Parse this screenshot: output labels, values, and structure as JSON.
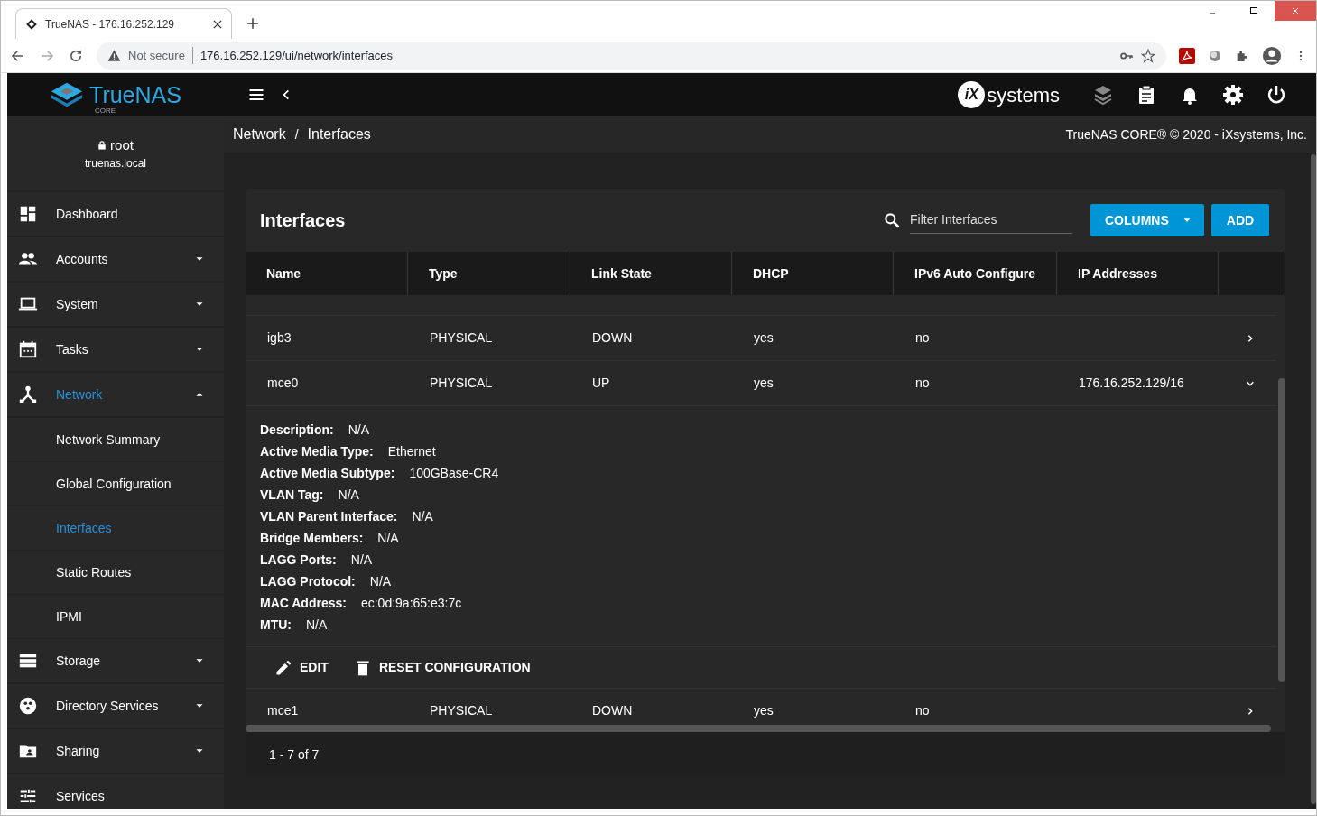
{
  "browser": {
    "tab_title": "TrueNAS - 176.16.252.129",
    "security": "Not secure",
    "url": "176.16.252.129/ui/network/interfaces"
  },
  "topbar": {
    "logo": "TrueNAS",
    "logo_sub": "CORE",
    "vendor_mark": "iX",
    "vendor_text": "systems"
  },
  "user": {
    "name": "root",
    "host": "truenas.local"
  },
  "sidebar": {
    "items": [
      {
        "label": "Dashboard",
        "kind": "dashboard",
        "expandable": false,
        "expanded": false,
        "selected": false
      },
      {
        "label": "Accounts",
        "kind": "accounts",
        "expandable": true,
        "expanded": false,
        "selected": false
      },
      {
        "label": "System",
        "kind": "system",
        "expandable": true,
        "expanded": false,
        "selected": false
      },
      {
        "label": "Tasks",
        "kind": "tasks",
        "expandable": true,
        "expanded": false,
        "selected": false
      },
      {
        "label": "Network",
        "kind": "network",
        "expandable": true,
        "expanded": true,
        "selected": true,
        "children": [
          {
            "label": "Network Summary",
            "selected": false
          },
          {
            "label": "Global Configuration",
            "selected": false
          },
          {
            "label": "Interfaces",
            "selected": true
          },
          {
            "label": "Static Routes",
            "selected": false
          },
          {
            "label": "IPMI",
            "selected": false
          }
        ]
      },
      {
        "label": "Storage",
        "kind": "storage",
        "expandable": true,
        "expanded": false,
        "selected": false
      },
      {
        "label": "Directory Services",
        "kind": "directory",
        "expandable": true,
        "expanded": false,
        "selected": false
      },
      {
        "label": "Sharing",
        "kind": "sharing",
        "expandable": true,
        "expanded": false,
        "selected": false
      },
      {
        "label": "Services",
        "kind": "services",
        "expandable": false,
        "expanded": false,
        "selected": false
      }
    ]
  },
  "breadcrumb": {
    "items": [
      "Network",
      "Interfaces"
    ],
    "separator": "/"
  },
  "copyright": "TrueNAS CORE® © 2020 - iXsystems, Inc.",
  "card": {
    "title": "Interfaces",
    "filter_placeholder": "Filter Interfaces",
    "columns_button": "COLUMNS",
    "add_button": "ADD"
  },
  "table": {
    "columns": [
      "Name",
      "Type",
      "Link State",
      "DHCP",
      "IPv6 Auto Configure",
      "IP Addresses"
    ],
    "rows": [
      {
        "cells": [
          "igb3",
          "PHYSICAL",
          "DOWN",
          "yes",
          "no",
          ""
        ],
        "expanded": false
      },
      {
        "cells": [
          "mce0",
          "PHYSICAL",
          "UP",
          "yes",
          "no",
          "176.16.252.129/16"
        ],
        "expanded": true,
        "details": [
          {
            "label": "Description:",
            "value": "N/A"
          },
          {
            "label": "Active Media Type:",
            "value": "Ethernet"
          },
          {
            "label": "Active Media Subtype:",
            "value": "100GBase-CR4"
          },
          {
            "label": "VLAN Tag:",
            "value": "N/A"
          },
          {
            "label": "VLAN Parent Interface:",
            "value": "N/A"
          },
          {
            "label": "Bridge Members:",
            "value": "N/A"
          },
          {
            "label": "LAGG Ports:",
            "value": "N/A"
          },
          {
            "label": "LAGG Protocol:",
            "value": "N/A"
          },
          {
            "label": "MAC Address:",
            "value": "ec:0d:9a:65:e3:7c"
          },
          {
            "label": "MTU:",
            "value": "N/A"
          }
        ],
        "actions": [
          {
            "label": "EDIT",
            "kind": "edit"
          },
          {
            "label": "RESET CONFIGURATION",
            "kind": "delete"
          }
        ]
      },
      {
        "cells": [
          "mce1",
          "PHYSICAL",
          "DOWN",
          "yes",
          "no",
          ""
        ],
        "expanded": false
      }
    ]
  },
  "pager": "1 - 7 of 7"
}
